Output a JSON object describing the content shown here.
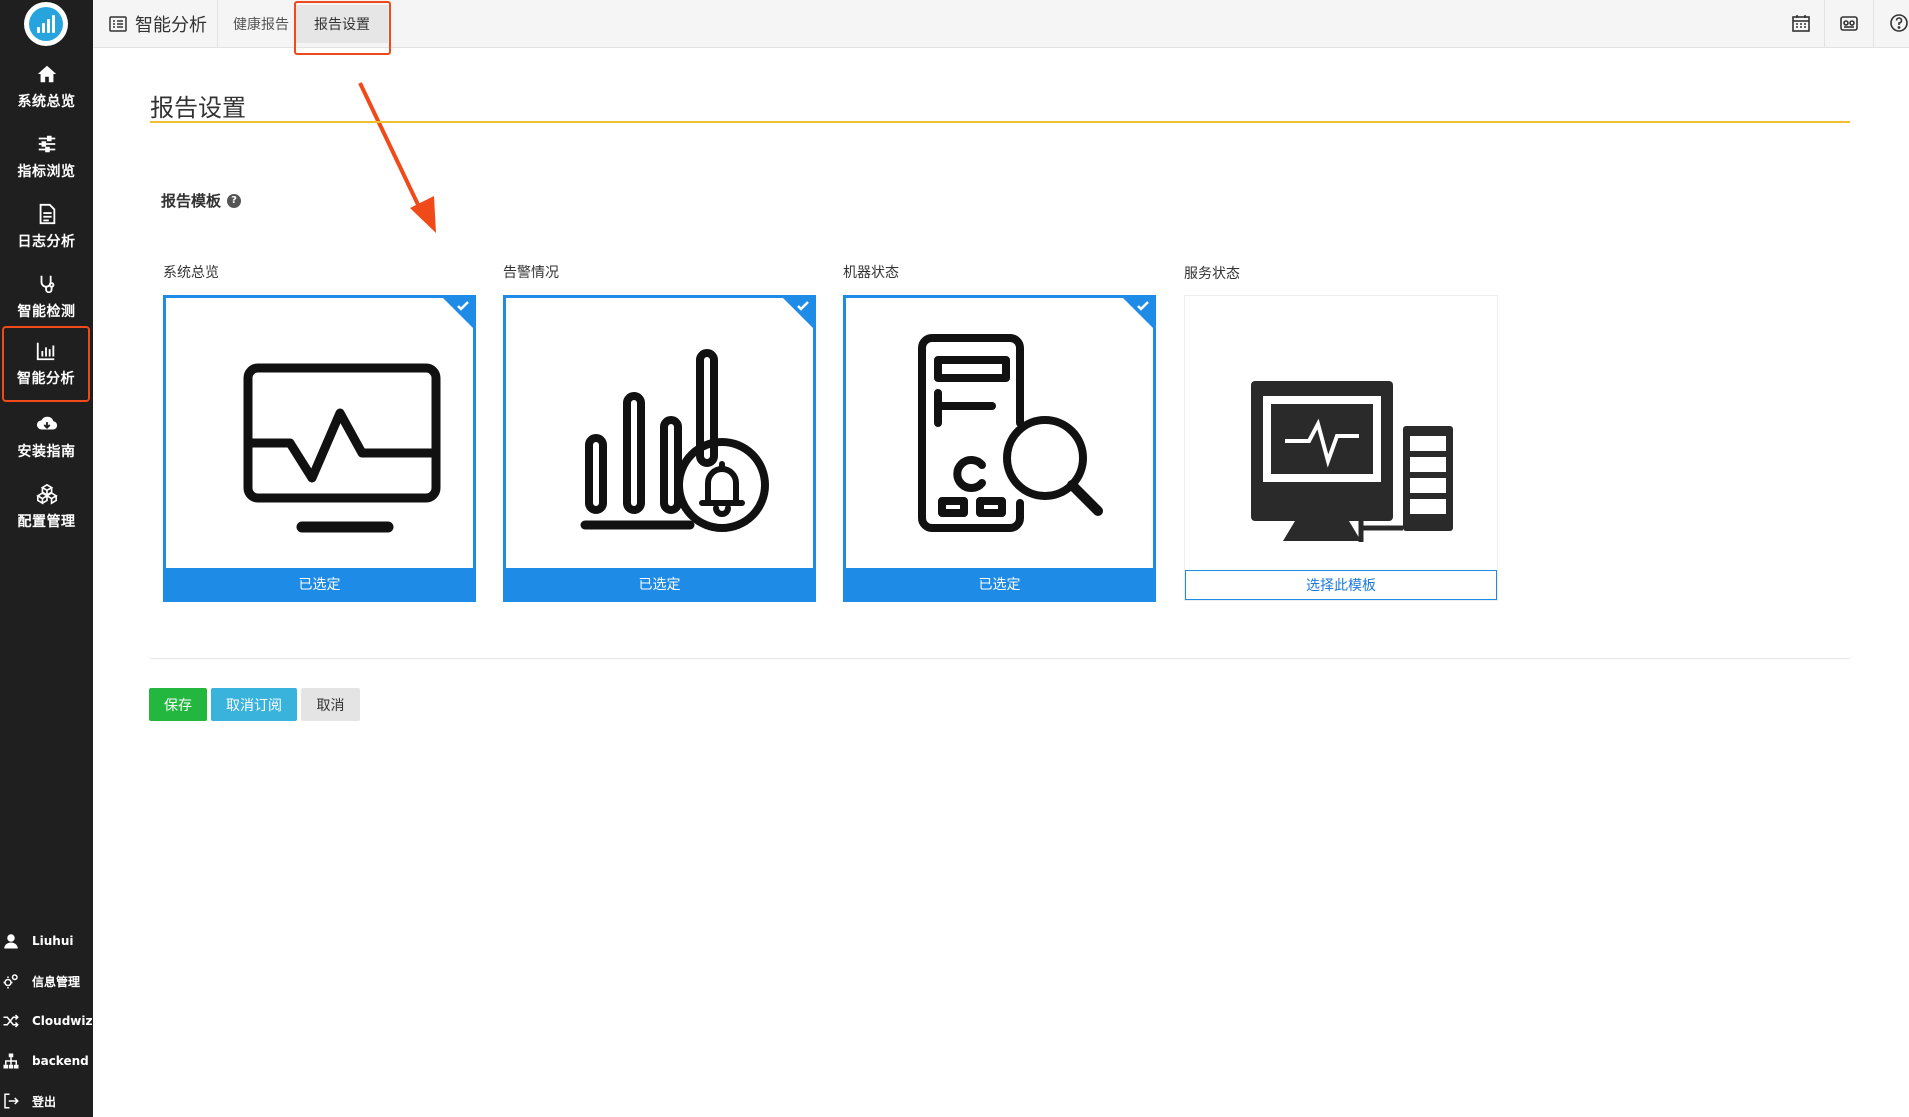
{
  "sidebar": {
    "items": [
      {
        "label": "系统总览",
        "icon": "home-icon"
      },
      {
        "label": "指标浏览",
        "icon": "sliders-icon"
      },
      {
        "label": "日志分析",
        "icon": "document-icon"
      },
      {
        "label": "智能检测",
        "icon": "stethoscope-icon"
      },
      {
        "label": "智能分析",
        "icon": "bar-chart-icon",
        "active": true
      },
      {
        "label": "安装指南",
        "icon": "cloud-download-icon"
      },
      {
        "label": "配置管理",
        "icon": "cubes-icon"
      }
    ],
    "bottom": [
      {
        "label": "Liuhui",
        "icon": "user-icon"
      },
      {
        "label": "信息管理",
        "icon": "gears-icon"
      },
      {
        "label": "Cloudwiz",
        "icon": "shuffle-icon"
      },
      {
        "label": "backend",
        "icon": "sitemap-icon"
      },
      {
        "label": "登出",
        "icon": "sign-out-icon"
      }
    ]
  },
  "topbar": {
    "module_title": "智能分析",
    "tabs": [
      {
        "label": "健康报告"
      },
      {
        "label": "报告设置",
        "active": true
      }
    ],
    "right_icons": [
      "calendar-icon",
      "dashboard-icon",
      "help-icon"
    ]
  },
  "main": {
    "page_title": "报告设置",
    "section_label": "报告模板",
    "templates": [
      {
        "label": "系统总览",
        "selected": true,
        "footer": "已选定"
      },
      {
        "label": "告警情况",
        "selected": true,
        "footer": "已选定"
      },
      {
        "label": "机器状态",
        "selected": true,
        "footer": "已选定"
      },
      {
        "label": "服务状态",
        "selected": false,
        "footer": "选择此模板"
      }
    ],
    "buttons": {
      "save": "保存",
      "unsubscribe": "取消订阅",
      "cancel": "取消"
    }
  },
  "colors": {
    "sidebar_bg": "#1f1f1f",
    "accent_blue": "#1e8be6",
    "highlight": "#f04a1a",
    "title_underline": "#f0c030",
    "save_green": "#24b740",
    "unsubscribe_blue": "#39b3dc"
  }
}
